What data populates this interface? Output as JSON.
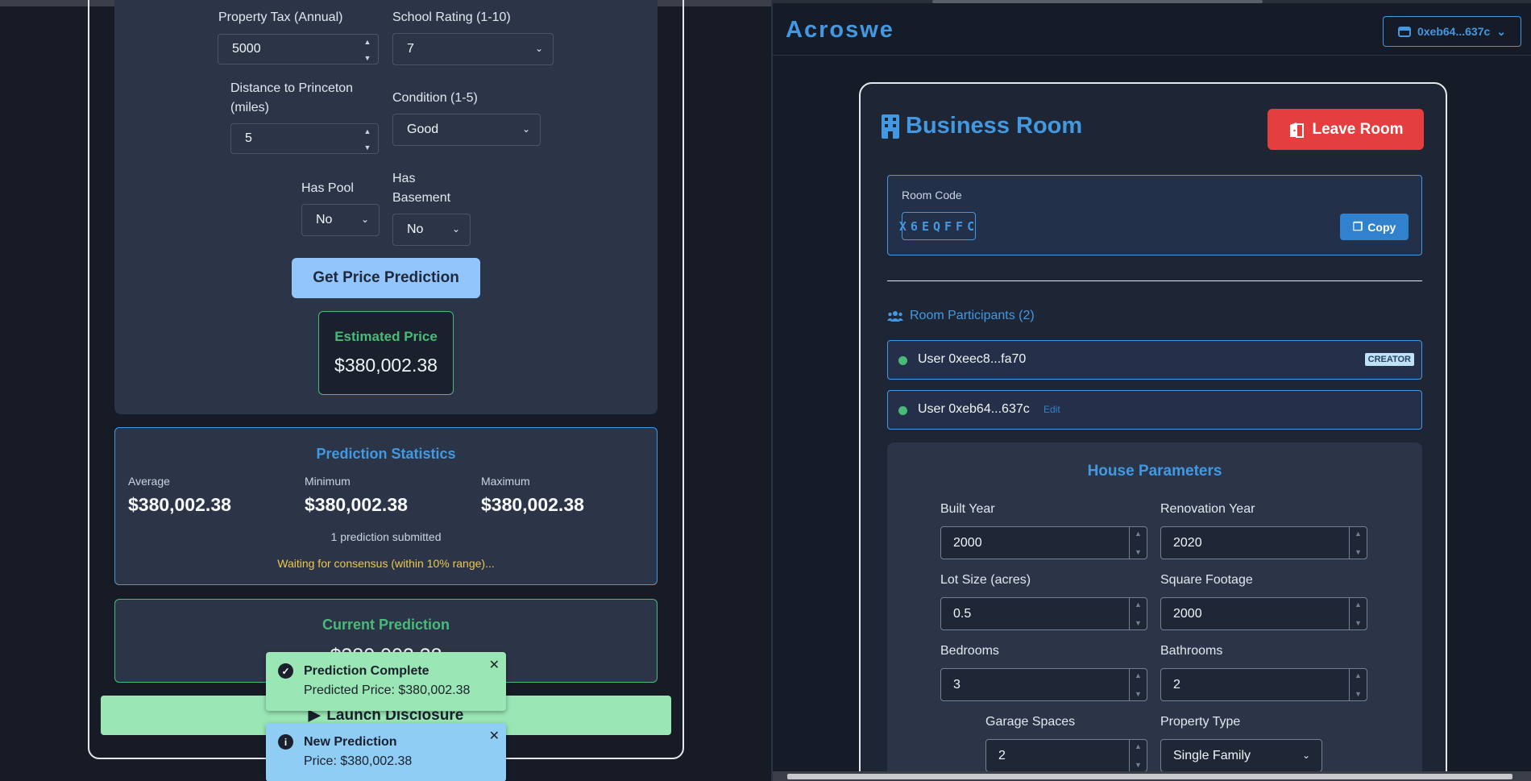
{
  "left": {
    "form": {
      "property_tax_label": "Property Tax (Annual)",
      "property_tax_value": "5000",
      "school_rating_label": "School Rating (1-10)",
      "school_rating_value": "7",
      "distance_label_line1": "Distance to Princeton",
      "distance_label_line2": "(miles)",
      "distance_value": "5",
      "condition_label": "Condition (1-5)",
      "condition_value": "Good",
      "pool_label": "Has Pool",
      "pool_value": "No",
      "basement_label_line1": "Has",
      "basement_label_line2": "Basement",
      "basement_value": "No"
    },
    "predict_button": "Get Price Prediction",
    "estimate": {
      "title": "Estimated Price",
      "value": "$380,002.38"
    },
    "stats": {
      "title": "Prediction Statistics",
      "average_label": "Average",
      "average_value": "$380,002.38",
      "minimum_label": "Minimum",
      "minimum_value": "$380,002.38",
      "maximum_label": "Maximum",
      "maximum_value": "$380,002.38",
      "count": "1 prediction submitted",
      "status": "Waiting for consensus (within 10% range)..."
    },
    "current": {
      "title": "Current Prediction",
      "value": "$380,002.38"
    },
    "launch_button": "Launch Disclosure",
    "toasts": [
      {
        "title": "Prediction Complete",
        "desc": "Predicted Price: $380,002.38",
        "color": "#9ae6b4",
        "icon": "check-circle-icon"
      },
      {
        "title": "New Prediction",
        "desc": "Price: $380,002.38",
        "color": "#90cdf4",
        "icon": "info-circle-icon"
      }
    ]
  },
  "right": {
    "brand": "Acroswe",
    "wallet": "0xeb64...637c",
    "room": {
      "title": "Business Room",
      "leave_button": "Leave Room",
      "code_label": "Room Code",
      "code": "X6EQFFC",
      "copy_button": "Copy",
      "participants_title": "Room Participants (2)",
      "participants": [
        {
          "name": "User 0xeec8...fa70",
          "badge": "CREATOR"
        },
        {
          "name": "User 0xeb64...637c",
          "action": "Edit"
        }
      ]
    },
    "params": {
      "title": "House Parameters",
      "built_year_label": "Built Year",
      "built_year": "2000",
      "renovation_year_label": "Renovation Year",
      "renovation_year": "2020",
      "lot_size_label": "Lot Size (acres)",
      "lot_size": "0.5",
      "square_footage_label": "Square Footage",
      "square_footage": "2000",
      "bedrooms_label": "Bedrooms",
      "bedrooms": "3",
      "bathrooms_label": "Bathrooms",
      "bathrooms": "2",
      "garage_label": "Garage Spaces",
      "garage": "2",
      "property_type_label": "Property Type",
      "property_type": "Single Family"
    }
  },
  "colors": {
    "accent_blue": "#4299e1",
    "success_green": "#48bb78",
    "danger_red": "#e53e3e",
    "warning_yellow": "#ecc94b"
  }
}
